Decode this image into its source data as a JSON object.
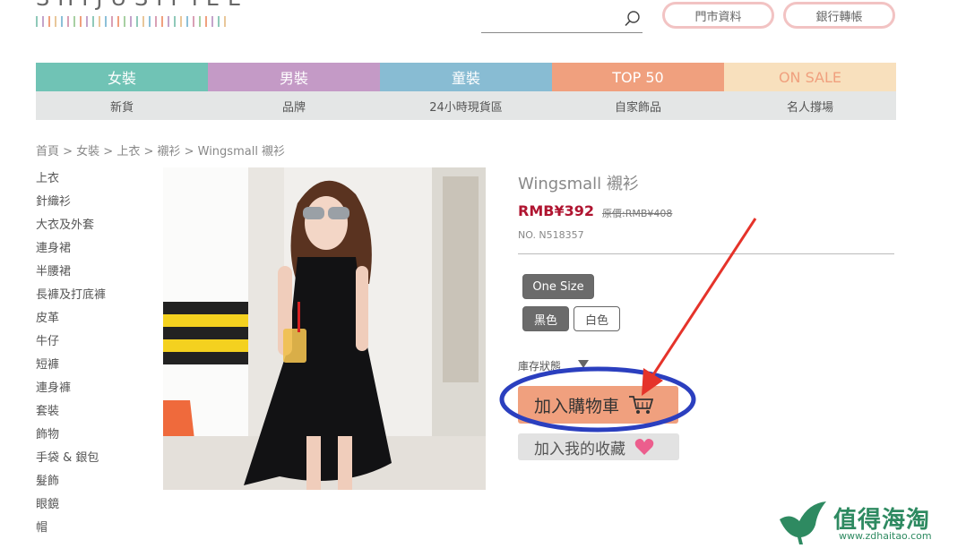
{
  "header": {
    "logo_text": "SHIJUSIPIEE",
    "logo_stripe_colors": [
      "#8fc9b9",
      "#c4a4cb",
      "#f0a07e",
      "#e9c79a",
      "#8cc0d8",
      "#d9a0b5",
      "#a7d0a2",
      "#f0a07e",
      "#c4a4cb",
      "#8fc9b9",
      "#e9c79a",
      "#8cc0d8",
      "#d9a0b5",
      "#f0a07e",
      "#a7d0a2",
      "#c4a4cb",
      "#8fc9b9",
      "#e9c79a",
      "#8cc0d8",
      "#d9a0b5",
      "#f0a07e",
      "#c4a4cb",
      "#8fc9b9",
      "#e9c79a",
      "#8cc0d8",
      "#d9a0b5",
      "#a7d0a2",
      "#f0a07e",
      "#c4a4cb",
      "#8fc9b9",
      "#e9c79a",
      "#8cc0d8",
      "#d9a0b5",
      "#f0a07e",
      "#a7d0a2"
    ],
    "search_icon": "search-icon",
    "store_info_label": "門市資料",
    "bank_transfer_label": "銀行轉帳"
  },
  "nav": {
    "items": [
      {
        "label": "女裝",
        "color": "#70c3b5"
      },
      {
        "label": "男裝",
        "color": "#c49ac6"
      },
      {
        "label": "童裝",
        "color": "#88bcd3"
      },
      {
        "label": "TOP 50",
        "color": "#f0a07e"
      },
      {
        "label": "ON SALE",
        "color": "#f8e0bd",
        "text_color": "#f0a07e"
      }
    ],
    "sub_items": [
      "新貨",
      "品牌",
      "24小時現貨區",
      "自家飾品",
      "名人撐場"
    ]
  },
  "breadcrumb": "首頁 > 女裝 > 上衣 > 襯衫 > Wingsmall 襯衫",
  "sidebar": {
    "items": [
      "上衣",
      "針織衫",
      "大衣及外套",
      "連身裙",
      "半腰裙",
      "長褲及打底褲",
      "皮革",
      "牛仔",
      "短褲",
      "連身褲",
      "套裝",
      "飾物",
      "手袋 & 銀包",
      "髮飾",
      "眼鏡",
      "帽"
    ]
  },
  "product": {
    "title": "Wingsmall 襯衫",
    "price": "RMB¥392",
    "original_price": "原價:RMB¥408",
    "number": "NO. N518357",
    "size_option": "One Size",
    "color_options": [
      "黑色",
      "白色"
    ],
    "selected_color": "黑色",
    "stock_label": "庫存狀態",
    "add_to_cart_label": "加入購物車",
    "add_to_favorites_label": "加入我的收藏",
    "cart_icon": "shopping-cart-icon",
    "heart_icon": "heart-icon"
  },
  "annotation": {
    "ellipse_color": "#2b3fbf",
    "arrow_color": "#e5332a"
  },
  "watermark": {
    "title": "值得海淘",
    "url": "www.zdhaitao.com"
  }
}
